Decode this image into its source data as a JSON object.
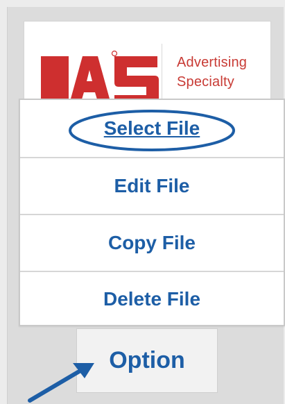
{
  "logo": {
    "brand_text_line_1": "Advertising",
    "brand_text_line_2": "Specialty"
  },
  "menu": {
    "items": [
      {
        "label": "Select File"
      },
      {
        "label": "Edit File"
      },
      {
        "label": "Copy File"
      },
      {
        "label": "Delete File"
      }
    ]
  },
  "option_button": {
    "label": "Option"
  },
  "colors": {
    "accent_blue": "#1d5ea6",
    "logo_red": "#c83a34",
    "panel_gray": "#dcdcdc"
  },
  "icons": {
    "highlight_ring": "highlight-ring-icon",
    "pointer_arrow": "pointer-arrow-icon",
    "logo_mark": "asi-logo-icon"
  }
}
